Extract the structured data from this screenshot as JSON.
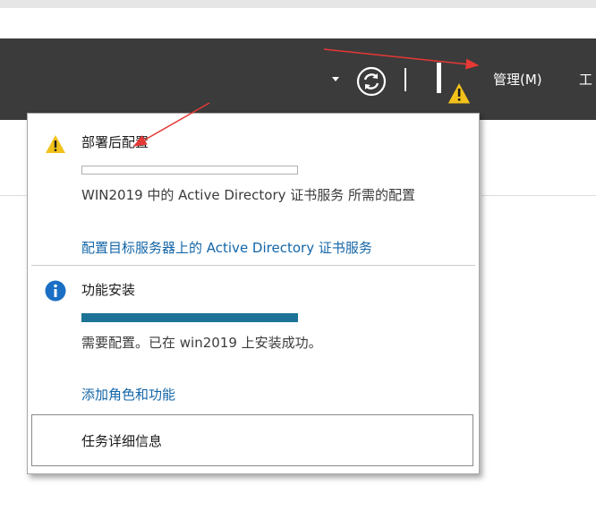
{
  "toolbar": {
    "manage_label": "管理(M)",
    "tools_label": "工",
    "icons": [
      "dropdown-caret-icon",
      "refresh-icon",
      "notification-flag-icon",
      "warning-icon"
    ],
    "warning_color": "#f2c21b",
    "bar_color": "#3b3b3b"
  },
  "notifications": {
    "items": [
      {
        "title": "部署后配置",
        "icon": "warning-icon",
        "progress": 0.0,
        "description": "WIN2019 中的 Active Directory 证书服务 所需的配置",
        "link": "配置目标服务器上的 Active Directory 证书服务"
      },
      {
        "title": "功能安装",
        "icon": "info-icon",
        "progress": 1.0,
        "description": "需要配置。已在 win2019 上安装成功。",
        "link": "添加角色和功能"
      }
    ],
    "task_details_label": "任务详细信息",
    "progress_color": "#1c7397",
    "link_color": "#1466a8",
    "info_color": "#1a6fc4"
  }
}
